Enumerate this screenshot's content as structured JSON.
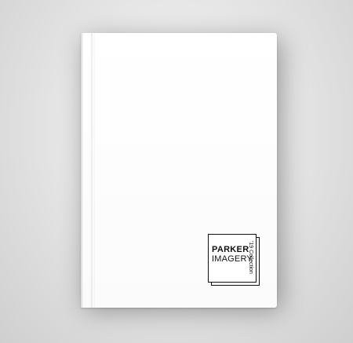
{
  "cover": {
    "logo": {
      "line1": "PARKER",
      "line2": "IMAGERY",
      "side_text": "'19 Collection"
    }
  },
  "colors": {
    "background": "#e2e2e2",
    "book": "#ffffff",
    "logo_ink": "#111111"
  }
}
